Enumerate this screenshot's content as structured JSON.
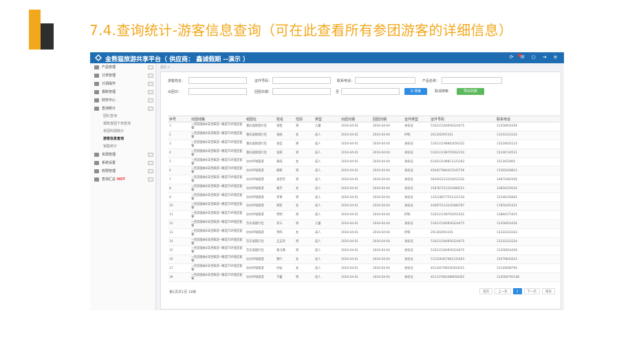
{
  "slide": {
    "title": "7.4.查询统计-游客信息查询（可在此查看所有参团游客的详细信息）",
    "colors": {
      "title": "#f2a81d",
      "header": "#1e6db3",
      "primary": "#2d8be0",
      "success": "#5cb85c"
    }
  },
  "app": {
    "brand": "金熊猫旅游共享平台（ 供应商： 鑫诚假期 --演示 ）",
    "tool_icons": [
      "refresh-icon",
      "message-icon",
      "chat-icon",
      "logout-icon",
      "menu-icon"
    ]
  },
  "sidebar": {
    "items": [
      {
        "label": "产品管理",
        "kind": "main"
      },
      {
        "label": "订单管理",
        "kind": "main"
      },
      {
        "label": "计调操作",
        "kind": "main"
      },
      {
        "label": "报账管理",
        "kind": "main"
      },
      {
        "label": "财务中心",
        "kind": "main"
      },
      {
        "label": "查询统计",
        "kind": "main"
      },
      {
        "label": "团队查询",
        "kind": "sub"
      },
      {
        "label": "报账查团下单查询",
        "kind": "sub"
      },
      {
        "label": "单团利润统计",
        "kind": "sub"
      },
      {
        "label": "游客信息查询",
        "kind": "sub-active"
      },
      {
        "label": "销售统计",
        "kind": "sub"
      },
      {
        "label": "资源管理",
        "kind": "main"
      },
      {
        "label": "系统设置",
        "kind": "main"
      },
      {
        "label": "权限管理",
        "kind": "main"
      },
      {
        "label": "查询汇总",
        "kind": "main",
        "hot": "HOT"
      }
    ]
  },
  "breadcrumb": "首页 >",
  "filters": {
    "tourist_name": "游客姓名：",
    "id_number": "证件号码：",
    "contact_phone": "联系电话：",
    "product_name": "产品名称：",
    "depart_date": "出团日：",
    "return_date": "回团日期：",
    "to": "至",
    "search": "Q 搜索",
    "cancel": "取消搜索",
    "export": "导出列表"
  },
  "table": {
    "headers": [
      "序号",
      "出团线路",
      "组团社",
      "姓名",
      "性别",
      "类型",
      "出团日期",
      "回团日期",
      "证件类型",
      "证件号码",
      "联系电话"
    ],
    "rows": [
      [
        "1",
        "~西双版纳4日西和游~精选TOP酒店套餐",
        "重庆国际旅行社",
        "张智",
        "男",
        "儿童",
        "2016-04-01",
        "2016-04-04",
        "身份证",
        "510211546956324475",
        "13356654456"
      ],
      [
        "2",
        "~西双版纳4日西和游~精选TOP酒店套餐",
        "重庆国际旅行社",
        "张丽",
        "女",
        "成人",
        "2016-04-01",
        "2016-04-04",
        "护照",
        "201302091101",
        "13333333333"
      ],
      [
        "3",
        "~西双版纳4日西和游~精选TOP酒店套餐",
        "重庆国际旅行社",
        "张芸",
        "男",
        "成人",
        "2016-04-01",
        "2016-04-04",
        "身份证",
        "510211198802056352",
        "13524654123"
      ],
      [
        "4",
        "~西双版纳4日西和游~精选TOP酒店套餐",
        "重庆国际旅行社",
        "张莉",
        "男",
        "成人",
        "2016-04-01",
        "2016-04-04",
        "身份证",
        "510211198705062154",
        "15246744521"
      ],
      [
        "5",
        "~西双版纳4日西和游~精选TOP酒店套餐",
        "达州环球旅游",
        "黄成",
        "女",
        "成人",
        "2016-04-01",
        "2016-04-04",
        "身份证",
        "612613198811225343",
        "1523452865"
      ],
      [
        "6",
        "~西双版纳4日西和游~精选TOP酒店套餐",
        "达州环球旅游",
        "顾和",
        "男",
        "成人",
        "2016-04-01",
        "2016-04-04",
        "身份证",
        "456457986421545756",
        "13565428812"
      ],
      [
        "7",
        "~西双版纳4日西和游~精选TOP酒店套餐",
        "达州环球旅游",
        "张世珍",
        "男",
        "成人",
        "2016-04-01",
        "2016-04-04",
        "身份证",
        "564452123154452332",
        "10875462956"
      ],
      [
        "8",
        "~西双版纳4日西和游~精选TOP酒店套餐",
        "达州环球旅游",
        "黄芳",
        "女",
        "成人",
        "2016-04-01",
        "2016-04-04",
        "身份证",
        "158787215354486521",
        "13854529542"
      ],
      [
        "9",
        "~西双版纳4日西和游~精选TOP酒店套餐",
        "达州环球旅游",
        "李青",
        "男",
        "成人",
        "2016-04-01",
        "2016-04-04",
        "身份证",
        "132128677551122134",
        "15246256842"
      ],
      [
        "10",
        "~西双版纳4日西和游~精选TOP酒店套餐",
        "达州环球旅游",
        "周凯",
        "女",
        "成人",
        "2016-04-01",
        "2016-04-04",
        "身份证",
        "446875123245488787",
        "17854265421"
      ],
      [
        "11",
        "~西双版纳4日西和游~精选TOP酒店套餐",
        "达州环球旅游",
        "李明",
        "男",
        "成人",
        "2016-04-01",
        "2016-04-04",
        "护照",
        "510211198702051452",
        "13884575425"
      ],
      [
        "12",
        "~西双版纳4日西和游~精选TOP酒店套餐",
        "苏东坡旅行社",
        "刘三",
        "男",
        "儿童",
        "2016-04-01",
        "2016-04-04",
        "身份证",
        "510211546956324475",
        "13356654456"
      ],
      [
        "13",
        "~西双版纳4日西和游~精选TOP酒店套餐",
        "达州环球旅游",
        "李四",
        "女",
        "成人",
        "2016-04-01",
        "2016-04-04",
        "护照",
        "201302091101",
        "13333333333"
      ],
      [
        "14",
        "~西双版纳4日西和游~精选TOP酒店套餐",
        "苏东坡旅行社",
        "王五玲",
        "男",
        "成人",
        "2016-04-01",
        "2016-04-04",
        "身份证",
        "510211546956324475",
        "13333333334"
      ],
      [
        "15",
        "~西双版纳4日西和游~精选TOP酒店套餐",
        "苏东坡旅行社",
        "黄马倩",
        "男",
        "成人",
        "2016-04-01",
        "2016-04-04",
        "身份证",
        "510211546956324475",
        "13356654456"
      ],
      [
        "16",
        "~西双版纳4日西和游~精选TOP酒店套餐",
        "达州环球旅游",
        "黎叶",
        "女",
        "成人",
        "2016-04-01",
        "2016-04-04",
        "身份证",
        "511526467981235463",
        "15679845633"
      ],
      [
        "17",
        "~西双版纳4日西和游~精选TOP酒店套餐",
        "达州环球旅游",
        "付坛",
        "女",
        "成人",
        "2016-04-01",
        "2016-04-04",
        "身份证",
        "451245798545454521",
        "12145698795"
      ],
      [
        "18",
        "~西双版纳4日西和游~精选TOP酒店套餐",
        "达州环球旅游",
        "于蓄",
        "男",
        "成人",
        "2016-04-01",
        "2016-04-04",
        "身份证",
        "451237983488958365",
        "12456879514B"
      ]
    ]
  },
  "pagination": {
    "info": "第1页共1页 18条",
    "first": "首页",
    "prev": "上一页",
    "current": "1",
    "next": "下一页",
    "last": "末页"
  }
}
